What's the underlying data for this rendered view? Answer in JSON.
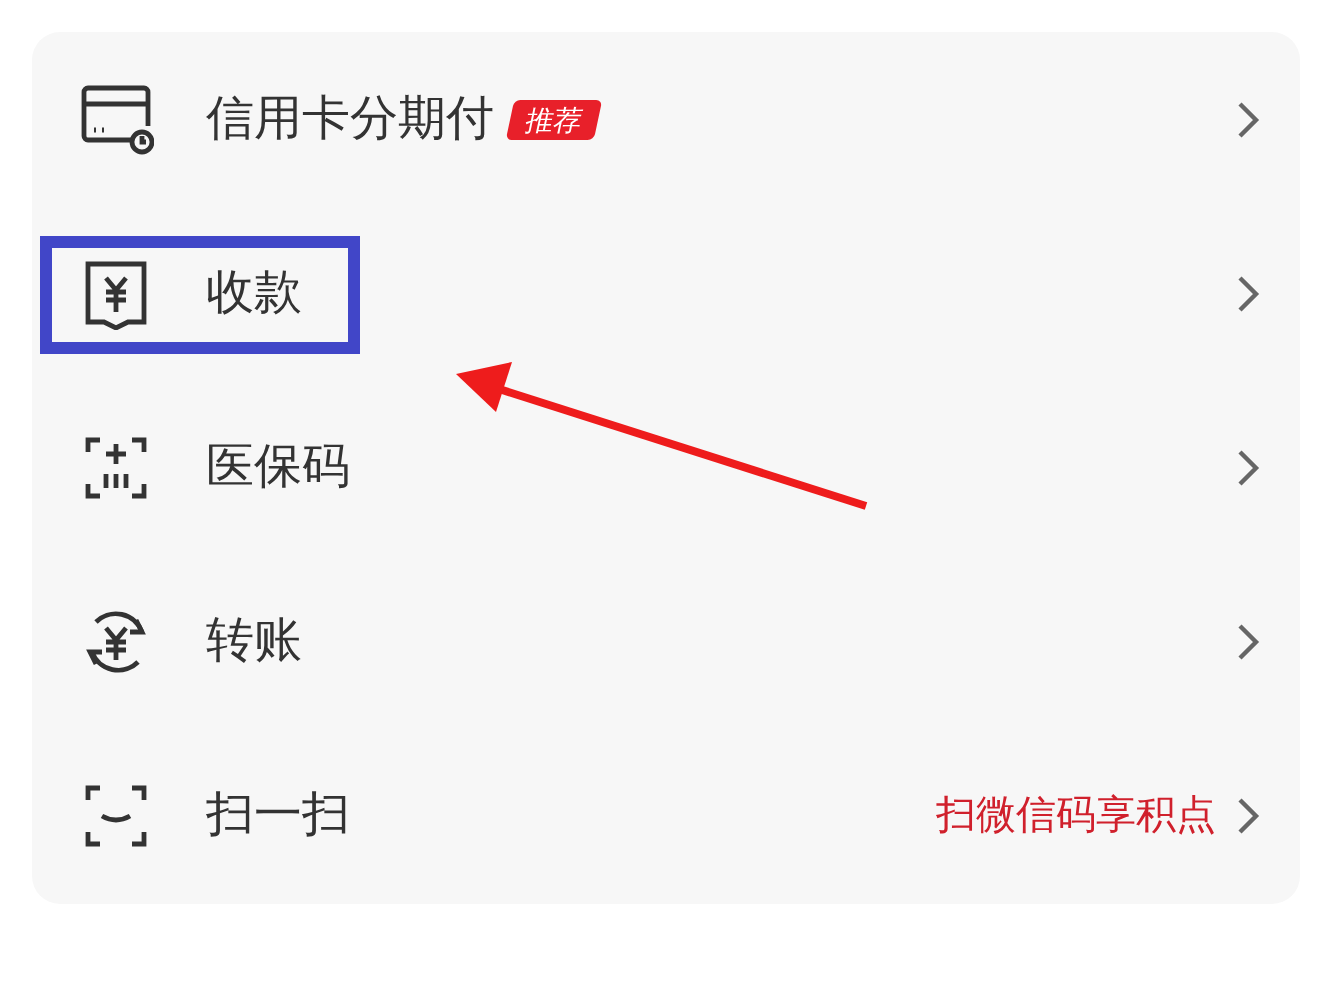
{
  "menu": {
    "items": [
      {
        "label": "信用卡分期付",
        "badge": "推荐",
        "highlighted": false
      },
      {
        "label": "收款",
        "highlighted": true
      },
      {
        "label": "医保码",
        "highlighted": false
      },
      {
        "label": "转账",
        "highlighted": false
      },
      {
        "label": "扫一扫",
        "promo": "扫微信码享积点",
        "highlighted": false
      }
    ]
  }
}
